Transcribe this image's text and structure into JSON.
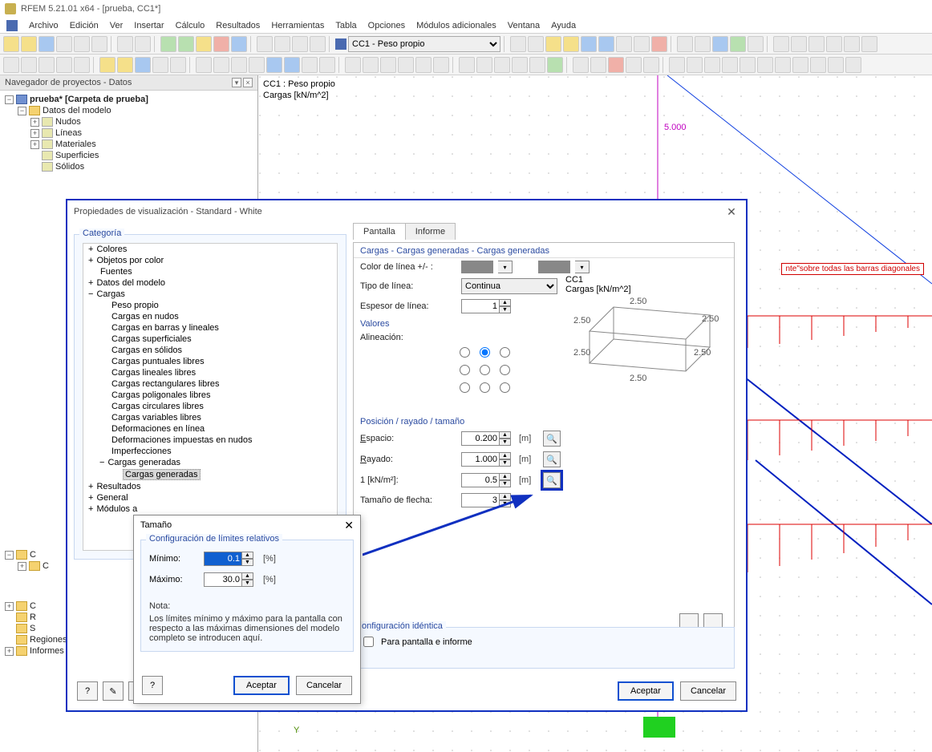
{
  "app": {
    "title": "RFEM 5.21.01 x64 - [prueba, CC1*]"
  },
  "menus": [
    "Archivo",
    "Edición",
    "Ver",
    "Insertar",
    "Cálculo",
    "Resultados",
    "Herramientas",
    "Tabla",
    "Opciones",
    "Módulos adicionales",
    "Ventana",
    "Ayuda"
  ],
  "toolbar": {
    "combo": "CC1 - Peso propio"
  },
  "navigator": {
    "title": "Navegador de proyectos - Datos",
    "root": "prueba* [Carpeta de prueba]",
    "modeldata": "Datos del modelo",
    "items": [
      "Nudos",
      "Líneas",
      "Materiales",
      "Superficies",
      "Sólidos"
    ],
    "bottom": [
      "C",
      "C",
      "R",
      "S",
      "Regiones medias",
      "Informes"
    ]
  },
  "canvas": {
    "caption1": "CC1 : Peso propio",
    "caption2": "Cargas [kN/m^2]",
    "loadval": "5.000",
    "ribbon": "nte\"sobre todas las barras diagonales"
  },
  "dialog": {
    "title": "Propiedades de visualización - Standard - White",
    "category_label": "Categoría",
    "categories_top": [
      "Colores",
      "Objetos por color",
      "Fuentes",
      "Datos del modelo"
    ],
    "cargas": "Cargas",
    "cargas_items": [
      "Peso propio",
      "Cargas en nudos",
      "Cargas en barras y lineales",
      "Cargas superficiales",
      "Cargas en sólidos",
      "Cargas puntuales libres",
      "Cargas lineales libres",
      "Cargas rectangulares libres",
      "Cargas poligonales libres",
      "Cargas circulares libres",
      "Cargas variables libres",
      "Deformaciones en línea",
      "Deformaciones impuestas en nudos",
      "Imperfecciones"
    ],
    "cargas_gen": "Cargas generadas",
    "cargas_gen_sel": "Cargas generadas",
    "categories_bottom": [
      "Resultados",
      "General",
      "Módulos a"
    ],
    "tabs": [
      "Pantalla",
      "Informe"
    ],
    "section1": "Cargas - Cargas generadas - Cargas generadas",
    "labels": {
      "colorlinea": "Color de línea +/- :",
      "tipolinea": "Tipo de línea:",
      "espesor": "Espesor de línea:",
      "continua": "Continua",
      "espesor_val": "1"
    },
    "cc_caption1": "CC1",
    "cc_caption2": "Cargas [kN/m^2]",
    "preview_val": "2.50",
    "section_valores": "Valores",
    "alineacion": "Alineación:",
    "section_pos": "Posición / rayado / tamaño",
    "pos": {
      "espacio": "Espacio:",
      "espacio_val": "0.200",
      "rayado": "Rayado:",
      "rayado_val": "1.000",
      "knm": "1 [kN/m²]:",
      "knm_val": "0.5",
      "flecha": "Tamaño de flecha:",
      "flecha_val": "3",
      "unit": "[m]"
    },
    "ident_label": "onfiguración idéntica",
    "ident_cb": "Para pantalla e informe",
    "accept": "Aceptar",
    "cancel": "Cancelar"
  },
  "dialog2": {
    "title": "Tamaño",
    "fs": "Configuración de límites relativos",
    "min_label": "Mínimo:",
    "min_val": "0.1",
    "max_label": "Máximo:",
    "max_val": "30.0",
    "unit": "[%]",
    "nota_label": "Nota:",
    "nota_text": "Los límites mínimo y máximo para la pantalla con respecto a las máximas dimensiones del modelo completo se introducen aquí.",
    "accept": "Aceptar",
    "cancel": "Cancelar"
  }
}
